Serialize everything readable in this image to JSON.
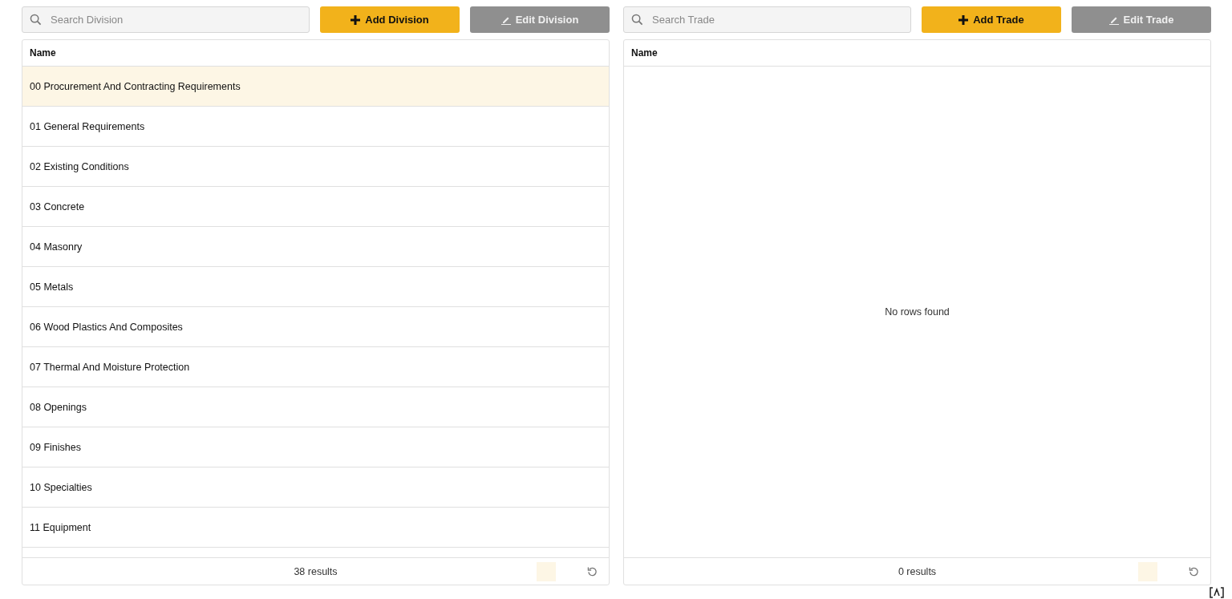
{
  "panels": [
    {
      "search": {
        "placeholder": "Search Division"
      },
      "add_button": "Add Division",
      "edit_button": "Edit Division",
      "table": {
        "columns": [
          "Name"
        ],
        "rows": [
          {
            "name": "00 Procurement And Contracting Requirements",
            "selected": true
          },
          {
            "name": "01 General Requirements",
            "selected": false
          },
          {
            "name": "02 Existing Conditions",
            "selected": false
          },
          {
            "name": "03 Concrete",
            "selected": false
          },
          {
            "name": "04 Masonry",
            "selected": false
          },
          {
            "name": "05 Metals",
            "selected": false
          },
          {
            "name": "06 Wood Plastics And Composites",
            "selected": false
          },
          {
            "name": "07 Thermal And Moisture Protection",
            "selected": false
          },
          {
            "name": "08 Openings",
            "selected": false
          },
          {
            "name": "09 Finishes",
            "selected": false
          },
          {
            "name": "10 Specialties",
            "selected": false
          },
          {
            "name": "11 Equipment",
            "selected": false
          }
        ],
        "footer": "38 results"
      }
    },
    {
      "search": {
        "placeholder": "Search Trade"
      },
      "add_button": "Add Trade",
      "edit_button": "Edit Trade",
      "table": {
        "columns": [
          "Name"
        ],
        "empty_message": "No rows found",
        "footer": "0 results"
      }
    }
  ]
}
